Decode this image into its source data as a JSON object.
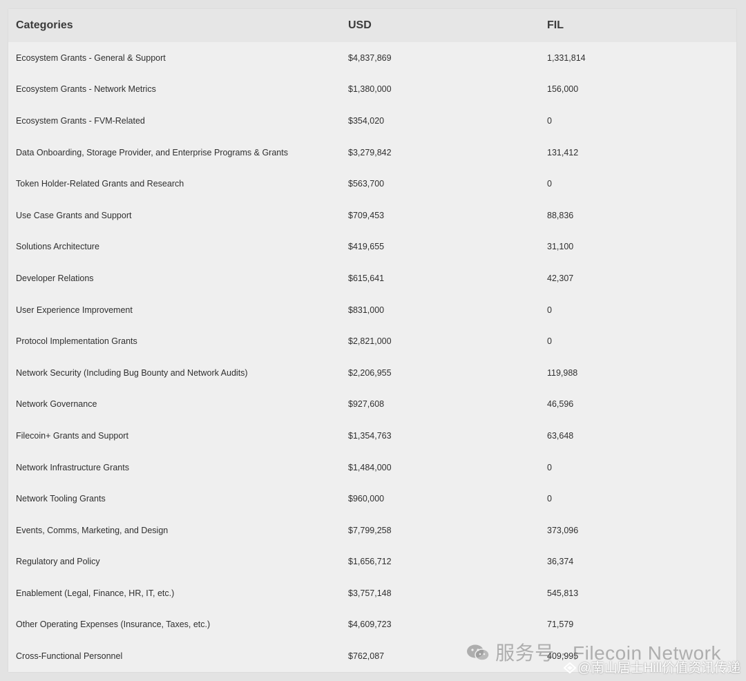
{
  "table": {
    "headers": [
      "Categories",
      "USD",
      "FIL"
    ],
    "rows": [
      [
        "Ecosystem Grants - General & Support",
        "$4,837,869",
        "1,331,814"
      ],
      [
        "Ecosystem Grants - Network Metrics",
        "$1,380,000",
        "156,000"
      ],
      [
        "Ecosystem Grants - FVM-Related",
        "$354,020",
        "0"
      ],
      [
        "Data Onboarding, Storage Provider, and Enterprise Programs & Grants",
        "$3,279,842",
        "131,412"
      ],
      [
        "Token Holder-Related Grants and Research",
        "$563,700",
        "0"
      ],
      [
        "Use Case Grants and Support",
        "$709,453",
        "88,836"
      ],
      [
        "Solutions Architecture",
        "$419,655",
        "31,100"
      ],
      [
        "Developer Relations",
        "$615,641",
        "42,307"
      ],
      [
        "User Experience Improvement",
        "$831,000",
        "0"
      ],
      [
        "Protocol Implementation Grants",
        "$2,821,000",
        "0"
      ],
      [
        "Network Security (Including Bug Bounty and Network Audits)",
        "$2,206,955",
        "119,988"
      ],
      [
        "Network Governance",
        "$927,608",
        "46,596"
      ],
      [
        "Filecoin+ Grants and Support",
        "$1,354,763",
        "63,648"
      ],
      [
        "Network Infrastructure Grants",
        "$1,484,000",
        "0"
      ],
      [
        "Network Tooling Grants",
        "$960,000",
        "0"
      ],
      [
        "Events, Comms, Marketing, and Design",
        "$7,799,258",
        "373,096"
      ],
      [
        "Regulatory and Policy",
        "$1,656,712",
        "36,374"
      ],
      [
        "Enablement (Legal, Finance, HR, IT, etc.)",
        "$3,757,148",
        "545,813"
      ],
      [
        "Other Operating Expenses (Insurance, Taxes, etc.)",
        "$4,609,723",
        "71,579"
      ],
      [
        "Cross-Functional Personnel",
        "$762,087",
        "409,995"
      ]
    ]
  },
  "watermark": {
    "main_text": "服务号 · Filecoin Network",
    "sub_text": "@南山居士Hill价值资讯传递",
    "icon": "wechat-icon"
  }
}
